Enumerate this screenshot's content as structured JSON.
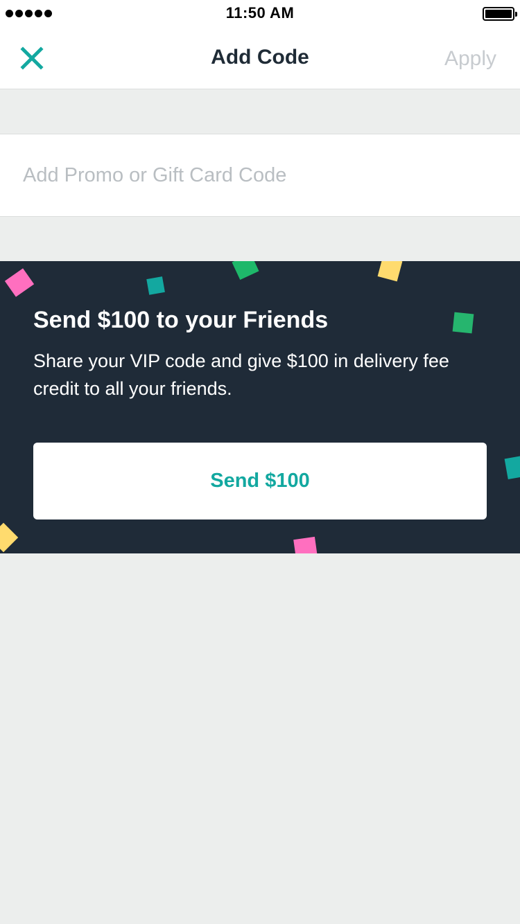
{
  "status_bar": {
    "time": "11:50 AM"
  },
  "nav": {
    "title": "Add Code",
    "apply_label": "Apply",
    "close_icon": "close-icon"
  },
  "code_input": {
    "value": "",
    "placeholder": "Add Promo or Gift Card Code"
  },
  "promo": {
    "title": "Send $100 to your Friends",
    "text": "Share your VIP code and give $100 in delivery fee credit to all your friends.",
    "button_label": "Send $100"
  },
  "colors": {
    "accent": "#13a8a0",
    "banner_bg": "#1f2b38",
    "page_bg": "#eceeed",
    "disabled_text": "#c7cbcf",
    "confetti_pink": "#ff6fbf",
    "confetti_teal": "#13a8a0",
    "confetti_green": "#1eb86a",
    "confetti_yellow": "#ffdb6e"
  }
}
